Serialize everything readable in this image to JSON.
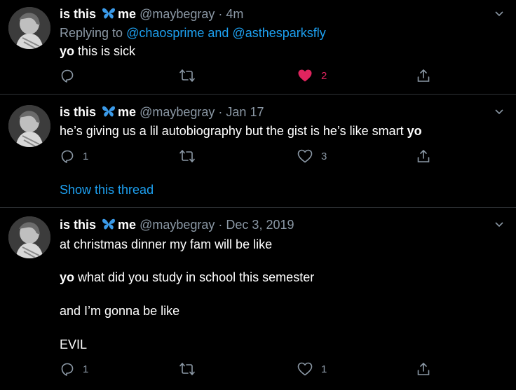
{
  "tweets": [
    {
      "name_a": "is this",
      "name_b": "me",
      "handle": "@maybegray",
      "sep": "·",
      "time": "4m",
      "replying_prefix": "Replying to",
      "replying_mentions": "@chaosprime and @asthesparksfly",
      "text_bold": "yo",
      "text_rest": "this is sick",
      "reply_count": "",
      "like_count": "2",
      "liked": true
    },
    {
      "name_a": "is this",
      "name_b": "me",
      "handle": "@maybegray",
      "sep": "·",
      "time": "Jan 17",
      "text_rest": "he’s giving us a lil autobiography but the gist is he’s like smart",
      "text_bold": "yo",
      "reply_count": "1",
      "like_count": "3",
      "liked": false,
      "thread_link": "Show this thread"
    },
    {
      "name_a": "is this",
      "name_b": "me",
      "handle": "@maybegray",
      "sep": "·",
      "time": "Dec 3, 2019",
      "line1": "at christmas dinner my fam will be like",
      "line2_bold": "yo",
      "line2_rest": "what did you study in school this semester",
      "line3": "and I’m gonna be like",
      "line4": "EVIL",
      "reply_count": "1",
      "like_count": "1",
      "liked": false
    }
  ],
  "colors": {
    "background": "#000000",
    "text": "#ffffff",
    "secondary": "#8b98a5",
    "link": "#1da1f2",
    "like": "#e0245e",
    "divider": "#2f3336"
  },
  "icons": {
    "reply": "reply-icon",
    "retweet": "retweet-icon",
    "like": "heart-icon",
    "share": "share-icon",
    "more": "chevron-down-icon",
    "emoji": "butterfly-emoji"
  }
}
